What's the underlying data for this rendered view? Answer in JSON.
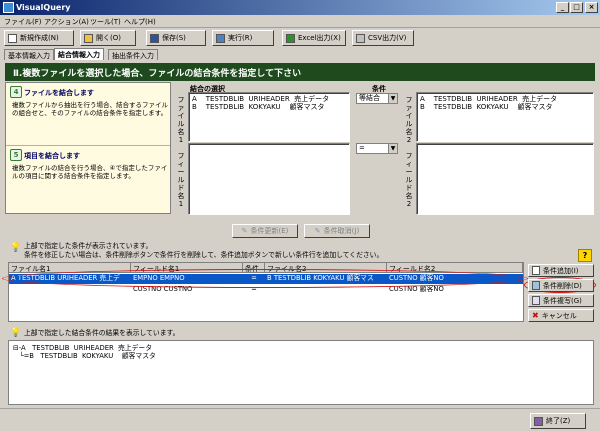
{
  "window": {
    "title": "VisualQuery",
    "min": "_",
    "max": "□",
    "close": "×"
  },
  "menu": [
    "ファイル(F)",
    "アクション(A)",
    "ツール(T)",
    "ヘルプ(H)"
  ],
  "toolbar": {
    "new": "新規作成(N)",
    "open": "開く(O)",
    "save": "保存(S)",
    "run": "実行(R)",
    "excel": "Excel出力(X)",
    "csv": "CSV出力(V)"
  },
  "tabs": [
    "基本情報入力",
    "結合情報入力",
    "抽出条件入力"
  ],
  "banner": "Ⅱ.複数ファイルを選択した場合、ファイルの結合条件を指定して下さい",
  "guide": {
    "s1": {
      "num": "4",
      "title": "ファイルを結合します",
      "desc": "複数ファイルから抽出を行う場合、結合するファイルの組合せと、そのファイルの結合条件を指定します。"
    },
    "s2": {
      "num": "5",
      "title": "項目を結合します",
      "desc": "複数ファイルの結合を行う場合、④で指定したファイルの項目に関する結合条件を指定します。"
    }
  },
  "join": {
    "selection_label": "結合の選択",
    "condition_label": "条件",
    "file1_vlabel": "ファイル名1",
    "file2_vlabel": "ファイル名2",
    "field1_vlabel": "フィールド名1",
    "field2_vlabel": "フィールド名2",
    "file1_rows": [
      "A    TESTDBLIB  URIHEADER  売上データ",
      "B    TESTDBLIB  KOKYAKU    顧客マスタ"
    ],
    "file2_rows": [
      "A    TESTDBLIB  URIHEADER  売上データ",
      "B    TESTDBLIB  KOKYAKU    顧客マスタ"
    ],
    "join_type": "等結合",
    "operator": "="
  },
  "mid_buttons": {
    "update": "条件更新(E)",
    "cancel": "条件取消(J)"
  },
  "info1": [
    "上部で指定した条件が表示されています。",
    "条件を修正したい場合は、条件削除ボタンで条件行を削除して、条件追加ボタンで新しい条件行を追加してください。"
  ],
  "grid": {
    "headers": [
      "ファイル名1",
      "フィールド名1",
      "条件",
      "ファイル名2",
      "フィールド名2"
    ],
    "rows": [
      [
        "A  TESTDBLIB  URIHEADER  売上デ",
        "EMPNO   EMPNO",
        "=",
        "B   TESTDBLIB  KOKYAKU   顧客マス",
        "CUSTNO  顧客NO"
      ],
      [
        "",
        "CUSTNO  CUSTNO",
        "=",
        "",
        "CUSTNO  顧客NO"
      ]
    ]
  },
  "right_buttons": {
    "add": "条件追加(I)",
    "delete": "条件削除(D)",
    "copy": "条件複写(G)",
    "cancel": "キャンセル"
  },
  "info2": "上部で指定した結合条件の結果を表示しています。",
  "tree": [
    "⊟-A   TESTDBLIB  URIHEADER  売上データ",
    "   └=B   TESTDBLIB  KOKYAKU    顧客マスタ"
  ],
  "help": "?",
  "footer": {
    "exit": "終了(Z)"
  }
}
